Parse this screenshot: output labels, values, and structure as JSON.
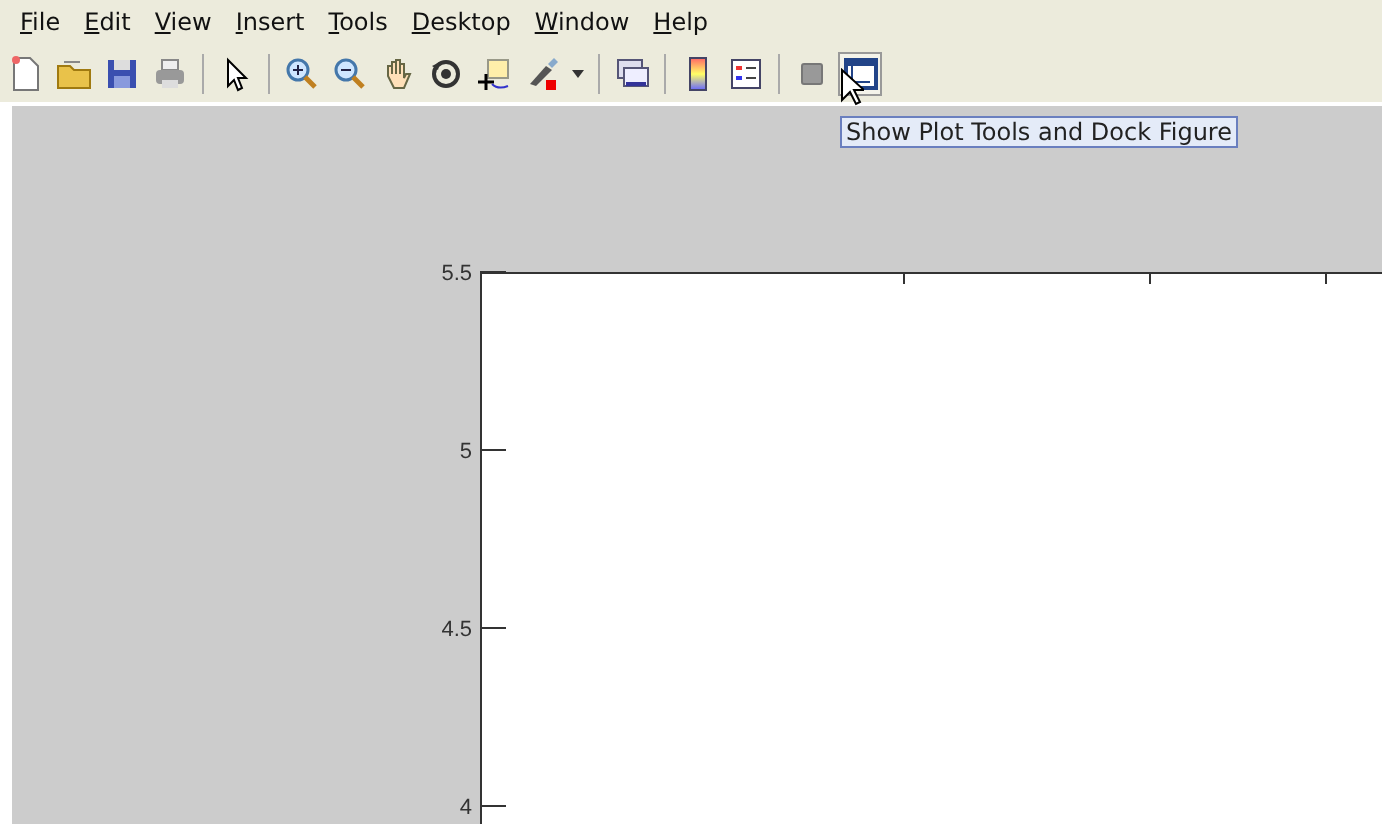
{
  "menu": [
    "File",
    "Edit",
    "View",
    "Insert",
    "Tools",
    "Desktop",
    "Window",
    "Help"
  ],
  "toolbar": [
    {
      "kind": "button",
      "pressed": false
    },
    {
      "kind": "button",
      "pressed": false
    },
    {
      "kind": "button",
      "pressed": false
    },
    {
      "kind": "button",
      "pressed": false
    },
    {
      "kind": "separator"
    },
    {
      "kind": "button",
      "pressed": false
    },
    {
      "kind": "separator"
    },
    {
      "kind": "button",
      "pressed": false
    },
    {
      "kind": "button",
      "pressed": false
    },
    {
      "kind": "button",
      "pressed": false
    },
    {
      "kind": "button",
      "pressed": false
    },
    {
      "kind": "button",
      "pressed": false
    },
    {
      "kind": "button",
      "pressed": false
    },
    {
      "kind": "dropdown"
    },
    {
      "kind": "separator"
    },
    {
      "kind": "button",
      "pressed": false
    },
    {
      "kind": "separator"
    },
    {
      "kind": "button",
      "pressed": false
    },
    {
      "kind": "button",
      "pressed": false
    },
    {
      "kind": "separator"
    },
    {
      "kind": "button",
      "pressed": false
    },
    {
      "kind": "button",
      "pressed": true
    }
  ],
  "tooltip": "Show Plot Tools and Dock Figure",
  "axes": {
    "y_tick_labels": [
      "5.5",
      "5",
      "4.5",
      "4"
    ]
  }
}
